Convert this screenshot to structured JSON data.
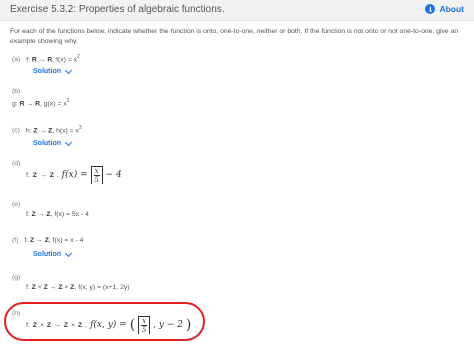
{
  "header": {
    "title": "Exercise 5.3.2: Properties of algebraic functions.",
    "about_label": "About",
    "about_icon": "info-icon"
  },
  "intro": "For each of the functions below, indicate whether the function is onto, one-to-one, neither or both. If the function is not onto or not one-to-one, give an example showing why.",
  "solution_label": "Solution",
  "parts": {
    "a": {
      "marker": "(a)",
      "prefix": "f:",
      "domain": "R",
      "arrow": "→",
      "codomain": "R",
      "rule": "f(x) = x",
      "exp": "2"
    },
    "b": {
      "marker": "(b)",
      "prefix": "g:",
      "domain": "R",
      "arrow": "→",
      "codomain": "R",
      "rule": "g(x) = x",
      "exp": "3"
    },
    "c": {
      "marker": "(c)",
      "prefix": "h:",
      "domain": "Z",
      "arrow": "→",
      "codomain": "Z",
      "rule": "h(x) = x",
      "exp": "3"
    },
    "d": {
      "marker": "(d)",
      "prefix": "f:",
      "domain": "Z",
      "arrow": "→",
      "codomain": "Z",
      "math_lhs": "f(x) =",
      "frac_num": "x",
      "frac_den": "5",
      "math_rhs": "− 4"
    },
    "e": {
      "marker": "(e)",
      "prefix": "f:",
      "domain": "Z",
      "arrow": "→",
      "codomain": "Z",
      "rule": "f(x) = 5x - 4"
    },
    "f": {
      "marker": "(f)",
      "prefix": "f:",
      "domain": "Z",
      "arrow": "→",
      "codomain": "Z",
      "rule": "f(x) = x - 4"
    },
    "g": {
      "marker": "(g)",
      "prefix": "f:",
      "domain": "Z",
      "times": "×",
      "domain2": "Z",
      "arrow": "→",
      "codomain": "Z",
      "codomain2": "Z",
      "rule": "f(x, y) = (x+1, 2y)"
    },
    "h": {
      "marker": "(h)",
      "prefix": "f:",
      "domain": "Z",
      "times": "×",
      "domain2": "Z",
      "arrow": "→",
      "codomain": "Z",
      "codomain2": "Z",
      "math_lhs": "f(x, y) =",
      "frac_num": "x",
      "frac_den": "5",
      "math_rhs": ", y − 2"
    }
  },
  "colors": {
    "accent": "#1a73e8",
    "highlight": "#e32020"
  }
}
